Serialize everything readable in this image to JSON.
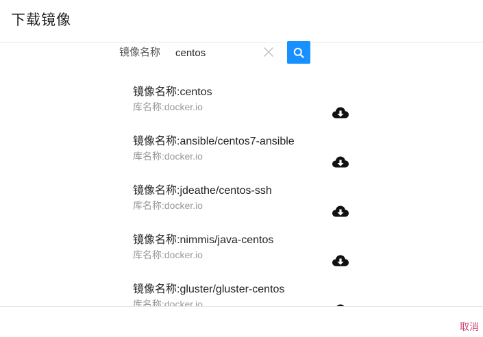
{
  "dialog": {
    "title": "下载镜像"
  },
  "search": {
    "label": "镜像名称",
    "value": "centos"
  },
  "results": [
    {
      "name": "镜像名称:centos",
      "repo": "库名称:docker.io"
    },
    {
      "name": "镜像名称:ansible/centos7-ansible",
      "repo": "库名称:docker.io"
    },
    {
      "name": "镜像名称:jdeathe/centos-ssh",
      "repo": "库名称:docker.io"
    },
    {
      "name": "镜像名称:nimmis/java-centos",
      "repo": "库名称:docker.io"
    },
    {
      "name": "镜像名称:gluster/gluster-centos",
      "repo": "库名称:docker.io"
    }
  ],
  "footer": {
    "cancel_label": "取消"
  },
  "icons": {
    "clear": "close-icon",
    "search": "search-icon",
    "download": "cloud-download-icon"
  },
  "colors": {
    "accent": "#1890ff",
    "cancel": "#d0457a",
    "secondary_text": "#999999"
  }
}
